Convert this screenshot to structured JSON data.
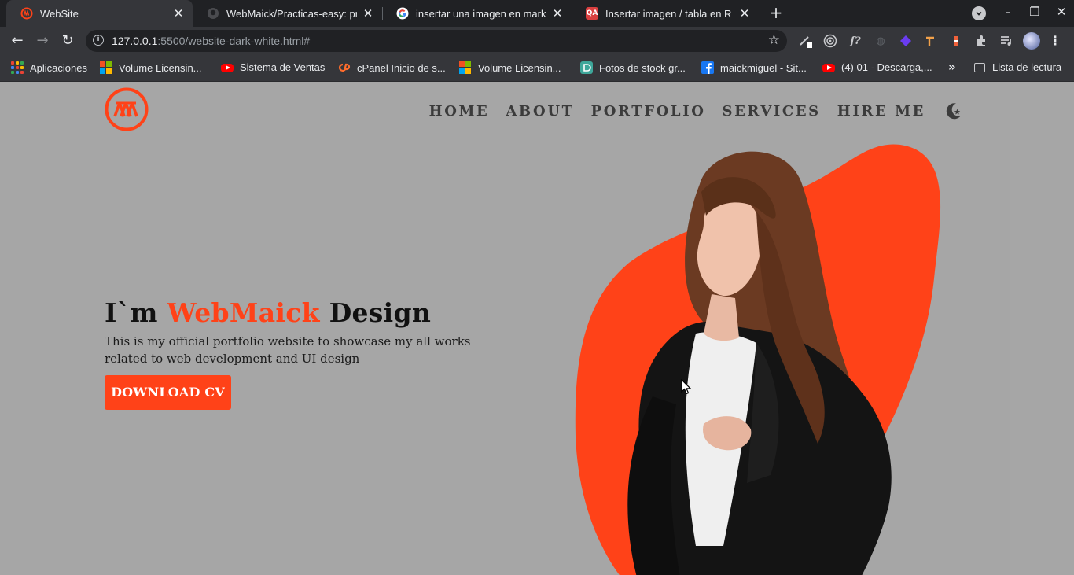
{
  "browser": {
    "tabs": [
      {
        "title": "WebSite",
        "active": true
      },
      {
        "title": "WebMaick/Practicas-easy: pra",
        "active": false
      },
      {
        "title": "insertar una imagen en mark",
        "active": false
      },
      {
        "title": "Insertar imagen / tabla en R N",
        "active": false
      }
    ],
    "favicon_labels": {
      "qa": "QA"
    },
    "url_host": "127.0.0.1",
    "url_rest": ":5500/website-dark-white.html#",
    "bookmarks": [
      {
        "label": "Aplicaciones",
        "icon": "apps-grid-icon"
      },
      {
        "label": "Volume Licensin...",
        "icon": "microsoft-icon"
      },
      {
        "label": "Sistema de Ventas",
        "icon": "youtube-icon"
      },
      {
        "label": "cPanel Inicio de s...",
        "icon": "cpanel-icon"
      },
      {
        "label": "Volume Licensin...",
        "icon": "microsoft-icon"
      },
      {
        "label": "Fotos de stock gr...",
        "icon": "stock-photo-icon"
      },
      {
        "label": "maickmiguel - Sit...",
        "icon": "facebook-icon"
      },
      {
        "label": "(4) 01 - Descarga,...",
        "icon": "youtube-icon"
      }
    ],
    "reading_list": "Lista de lectura"
  },
  "site": {
    "nav": [
      "HOME",
      "ABOUT",
      "PORTFOLIO",
      "SERVICES",
      "HIRE ME"
    ],
    "hero": {
      "title_prefix": "I`m ",
      "title_brand": "WebMaick",
      "title_suffix": " Design",
      "description": "This is my official portfolio website to showcase my all works related to web development and UI design",
      "cta_label": "DOWNLOAD CV"
    }
  },
  "colors": {
    "accent": "#ff4218",
    "page_background": "#a6a6a6",
    "tab_strip": "#202124",
    "toolbar": "#35363a"
  }
}
